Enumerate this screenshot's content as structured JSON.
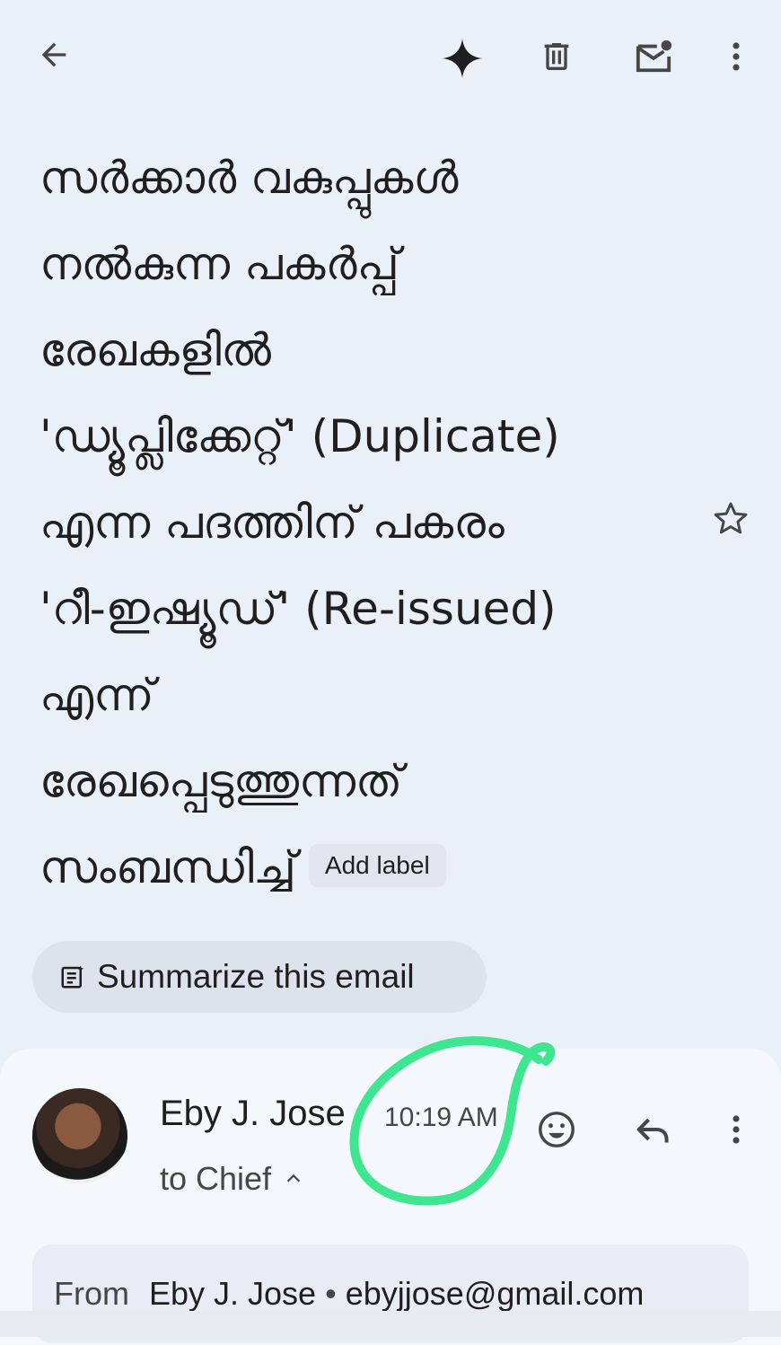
{
  "toolbar": {
    "back_icon": "arrow-left-icon",
    "gemini_icon": "sparkle-icon",
    "delete_icon": "trash-icon",
    "mark_unread_icon": "mail-unread-icon",
    "more_icon": "more-vert-icon"
  },
  "subject": {
    "lines": [
      "സർക്കാർ വകുപ്പുകൾ",
      "നൽകുന്ന പകർപ്പ്",
      "രേഖകളിൽ",
      "'ഡ്യൂപ്ലിക്കേറ്റ്' (Duplicate)",
      "എന്ന പദത്തിന് പകരം",
      "'റീ-ഇഷ്യൂഡ്' (Re-issued)",
      "എന്ന്",
      "രേഖപ്പെടുത്തുന്നത്",
      "സംബന്ധിച്ച്"
    ],
    "add_label": "Add label",
    "star_icon": "star-outline-icon"
  },
  "summarize": {
    "label": "Summarize this email",
    "icon": "summarize-icon"
  },
  "message": {
    "sender": "Eby J. Jose",
    "time": "10:19 AM",
    "to": "to Chief",
    "emoji_icon": "emoji-icon",
    "reply_icon": "reply-icon",
    "more_icon": "more-vert-icon",
    "from_label": "From",
    "from_name": "Eby J. Jose",
    "separator": "•",
    "from_email": "ebyjjose@gmail.com"
  },
  "colors": {
    "background": "#eaf0f8",
    "card": "#f4f7fc",
    "chip": "#e1e6ee",
    "annotation": "#3ee68f"
  }
}
